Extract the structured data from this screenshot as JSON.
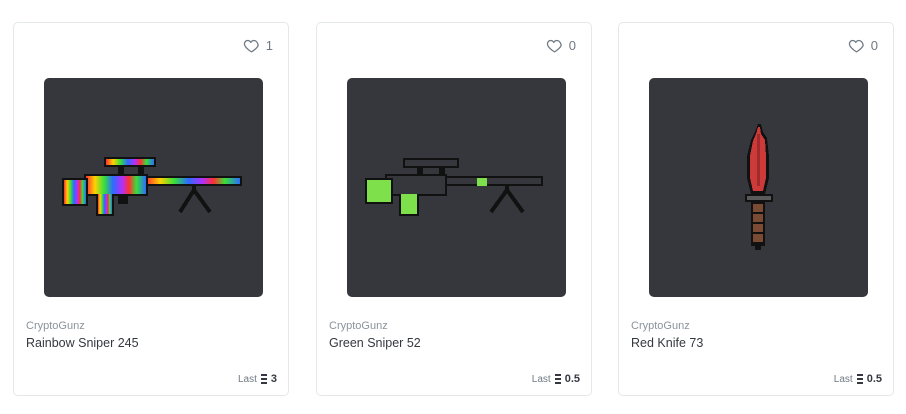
{
  "cards": [
    {
      "collection": "CryptoGunz",
      "name": "Rainbow Sniper 245",
      "favorites": "1",
      "last_label": "Last",
      "price": "3",
      "currency_icon": "ethereum-icon"
    },
    {
      "collection": "CryptoGunz",
      "name": "Green Sniper 52",
      "favorites": "0",
      "last_label": "Last",
      "price": "0.5",
      "currency_icon": "ethereum-icon"
    },
    {
      "collection": "CryptoGunz",
      "name": "Red Knife 73",
      "favorites": "0",
      "last_label": "Last",
      "price": "0.5",
      "currency_icon": "ethereum-icon"
    }
  ],
  "colors": {
    "image_background": "#36373c",
    "card_border": "#e5e8eb",
    "muted_text": "#8a939b",
    "title_text": "#353840"
  }
}
